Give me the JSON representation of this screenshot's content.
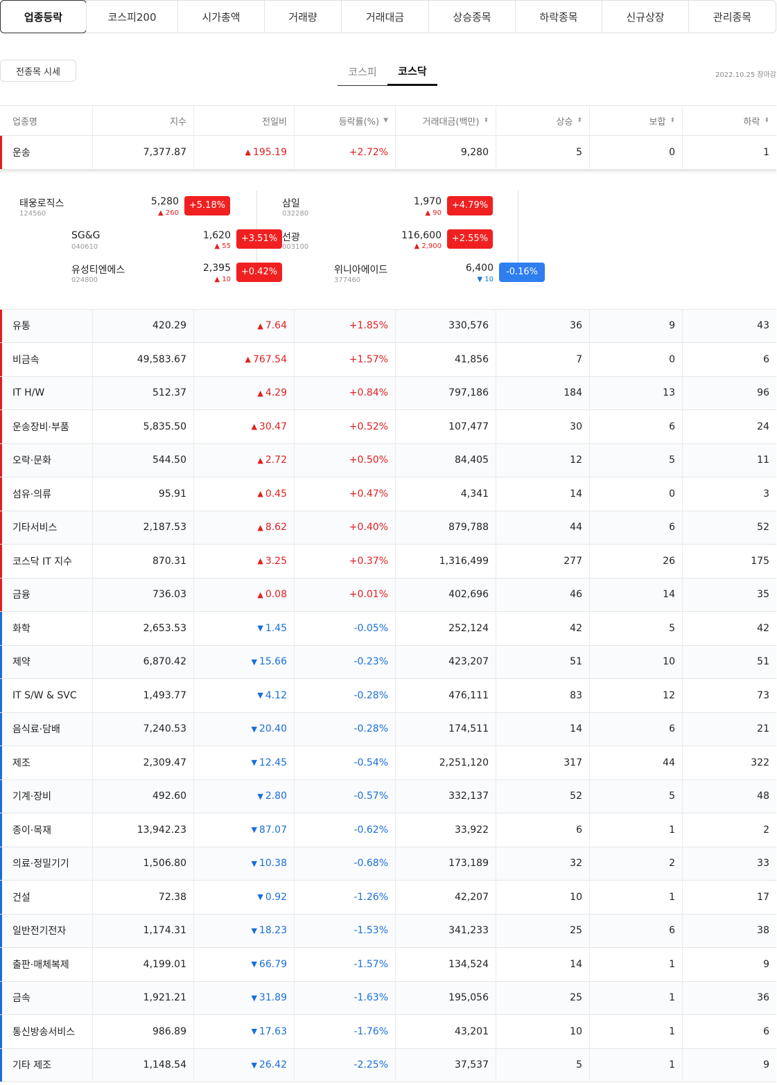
{
  "top_tabs": [
    "업종등락",
    "코스피200",
    "시가총액",
    "거래량",
    "거래대금",
    "상승종목",
    "하락종목",
    "신규상장",
    "관리종목"
  ],
  "all_button": "전종목 시세",
  "market_tabs": [
    "코스피",
    "코스닥"
  ],
  "date_label": "2022.10.25 장마감",
  "headers": [
    "업종명",
    "지수",
    "전일비",
    "등락률(%)",
    "거래대금(백만)",
    "상승",
    "보합",
    "하락"
  ],
  "colors": {
    "up": "#e02020",
    "down": "#1a6ed8"
  },
  "first_row": {
    "name": "운송",
    "index": "7,377.87",
    "dir": "up",
    "change": "195.19",
    "rate": "+2.72%",
    "amount": "9,280",
    "rise": "5",
    "flat": "0",
    "fall": "1"
  },
  "expanded": [
    {
      "name": "태웅로직스",
      "code": "124560",
      "price": "5,280",
      "change": "260",
      "dir": "up",
      "rate": "+5.18%"
    },
    {
      "name": "삼일",
      "code": "032280",
      "price": "1,970",
      "change": "90",
      "dir": "up",
      "rate": "+4.79%"
    },
    {
      "name": "SG&G",
      "code": "040610",
      "price": "1,620",
      "change": "55",
      "dir": "up",
      "rate": "+3.51%"
    },
    {
      "name": "선광",
      "code": "003100",
      "price": "116,600",
      "change": "2,900",
      "dir": "up",
      "rate": "+2.55%"
    },
    {
      "name": "유성티엔에스",
      "code": "024800",
      "price": "2,395",
      "change": "10",
      "dir": "up",
      "rate": "+0.42%"
    },
    {
      "name": "위니아에이드",
      "code": "377460",
      "price": "6,400",
      "change": "10",
      "dir": "down",
      "rate": "-0.16%"
    }
  ],
  "rows": [
    {
      "name": "유통",
      "index": "420.29",
      "dir": "up",
      "change": "7.64",
      "rate": "+1.85%",
      "amount": "330,576",
      "rise": "36",
      "flat": "9",
      "fall": "43"
    },
    {
      "name": "비금속",
      "index": "49,583.67",
      "dir": "up",
      "change": "767.54",
      "rate": "+1.57%",
      "amount": "41,856",
      "rise": "7",
      "flat": "0",
      "fall": "6"
    },
    {
      "name": "IT H/W",
      "index": "512.37",
      "dir": "up",
      "change": "4.29",
      "rate": "+0.84%",
      "amount": "797,186",
      "rise": "184",
      "flat": "13",
      "fall": "96"
    },
    {
      "name": "운송장비·부품",
      "index": "5,835.50",
      "dir": "up",
      "change": "30.47",
      "rate": "+0.52%",
      "amount": "107,477",
      "rise": "30",
      "flat": "6",
      "fall": "24"
    },
    {
      "name": "오락·문화",
      "index": "544.50",
      "dir": "up",
      "change": "2.72",
      "rate": "+0.50%",
      "amount": "84,405",
      "rise": "12",
      "flat": "5",
      "fall": "11"
    },
    {
      "name": "섬유·의류",
      "index": "95.91",
      "dir": "up",
      "change": "0.45",
      "rate": "+0.47%",
      "amount": "4,341",
      "rise": "14",
      "flat": "0",
      "fall": "3"
    },
    {
      "name": "기타서비스",
      "index": "2,187.53",
      "dir": "up",
      "change": "8.62",
      "rate": "+0.40%",
      "amount": "879,788",
      "rise": "44",
      "flat": "6",
      "fall": "52"
    },
    {
      "name": "코스닥 IT 지수",
      "index": "870.31",
      "dir": "up",
      "change": "3.25",
      "rate": "+0.37%",
      "amount": "1,316,499",
      "rise": "277",
      "flat": "26",
      "fall": "175"
    },
    {
      "name": "금융",
      "index": "736.03",
      "dir": "up",
      "change": "0.08",
      "rate": "+0.01%",
      "amount": "402,696",
      "rise": "46",
      "flat": "14",
      "fall": "35"
    },
    {
      "name": "화학",
      "index": "2,653.53",
      "dir": "down",
      "change": "1.45",
      "rate": "-0.05%",
      "amount": "252,124",
      "rise": "42",
      "flat": "5",
      "fall": "42"
    },
    {
      "name": "제약",
      "index": "6,870.42",
      "dir": "down",
      "change": "15.66",
      "rate": "-0.23%",
      "amount": "423,207",
      "rise": "51",
      "flat": "10",
      "fall": "51"
    },
    {
      "name": "IT S/W & SVC",
      "index": "1,493.77",
      "dir": "down",
      "change": "4.12",
      "rate": "-0.28%",
      "amount": "476,111",
      "rise": "83",
      "flat": "12",
      "fall": "73"
    },
    {
      "name": "음식료·담배",
      "index": "7,240.53",
      "dir": "down",
      "change": "20.40",
      "rate": "-0.28%",
      "amount": "174,511",
      "rise": "14",
      "flat": "6",
      "fall": "21"
    },
    {
      "name": "제조",
      "index": "2,309.47",
      "dir": "down",
      "change": "12.45",
      "rate": "-0.54%",
      "amount": "2,251,120",
      "rise": "317",
      "flat": "44",
      "fall": "322"
    },
    {
      "name": "기계·장비",
      "index": "492.60",
      "dir": "down",
      "change": "2.80",
      "rate": "-0.57%",
      "amount": "332,137",
      "rise": "52",
      "flat": "5",
      "fall": "48"
    },
    {
      "name": "종이·목재",
      "index": "13,942.23",
      "dir": "down",
      "change": "87.07",
      "rate": "-0.62%",
      "amount": "33,922",
      "rise": "6",
      "flat": "1",
      "fall": "2"
    },
    {
      "name": "의료·정밀기기",
      "index": "1,506.80",
      "dir": "down",
      "change": "10.38",
      "rate": "-0.68%",
      "amount": "173,189",
      "rise": "32",
      "flat": "2",
      "fall": "33"
    },
    {
      "name": "건설",
      "index": "72.38",
      "dir": "down",
      "change": "0.92",
      "rate": "-1.26%",
      "amount": "42,207",
      "rise": "10",
      "flat": "1",
      "fall": "17"
    },
    {
      "name": "일반전기전자",
      "index": "1,174.31",
      "dir": "down",
      "change": "18.23",
      "rate": "-1.53%",
      "amount": "341,233",
      "rise": "25",
      "flat": "6",
      "fall": "38"
    },
    {
      "name": "출판·매체복제",
      "index": "4,199.01",
      "dir": "down",
      "change": "66.79",
      "rate": "-1.57%",
      "amount": "134,524",
      "rise": "14",
      "flat": "1",
      "fall": "9"
    },
    {
      "name": "금속",
      "index": "1,921.21",
      "dir": "down",
      "change": "31.89",
      "rate": "-1.63%",
      "amount": "195,056",
      "rise": "25",
      "flat": "1",
      "fall": "36"
    },
    {
      "name": "통신방송서비스",
      "index": "986.89",
      "dir": "down",
      "change": "17.63",
      "rate": "-1.76%",
      "amount": "43,201",
      "rise": "10",
      "flat": "1",
      "fall": "6"
    },
    {
      "name": "기타 제조",
      "index": "1,148.54",
      "dir": "down",
      "change": "26.42",
      "rate": "-2.25%",
      "amount": "37,537",
      "rise": "5",
      "flat": "1",
      "fall": "9"
    }
  ]
}
